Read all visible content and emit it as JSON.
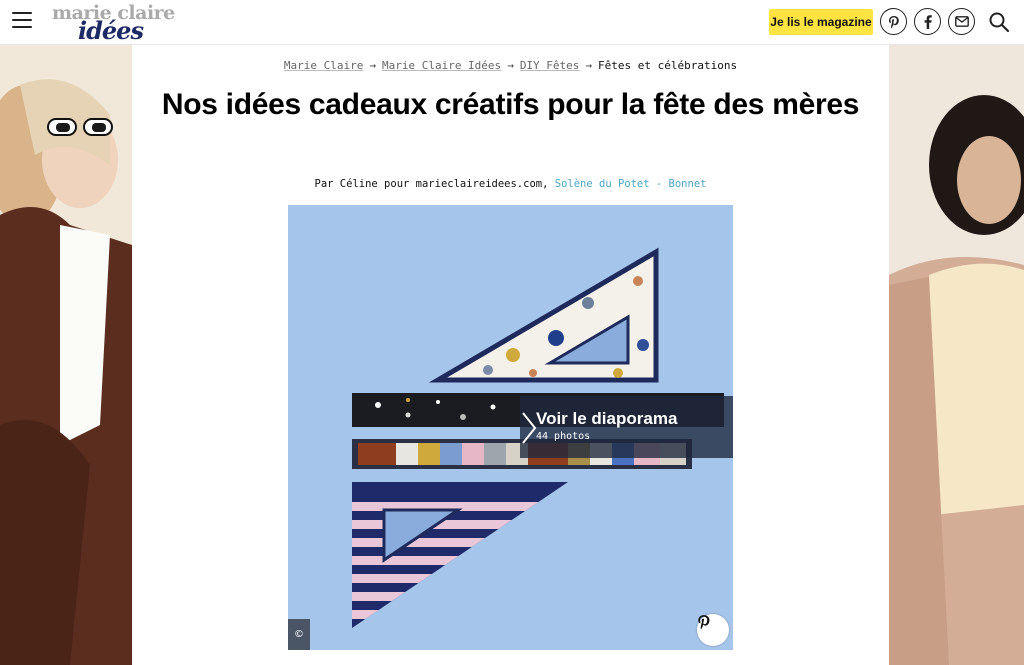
{
  "header": {
    "logo_top": "marie claire",
    "logo_bottom": "idées",
    "magazine_button": "Je lis le magazine",
    "social_icons": [
      "pinterest-icon",
      "facebook-icon",
      "newsletter-icon"
    ],
    "search_icon": "search-icon"
  },
  "breadcrumb": {
    "items": [
      "Marie Claire",
      "Marie Claire Idées",
      "DIY Fêtes"
    ],
    "current": "Fêtes et célébrations",
    "separator": "→"
  },
  "article": {
    "title": "Nos idées cadeaux créatifs pour la fête des mères",
    "byline_prefix": "Par Céline pour marieclaireidees.com,",
    "byline_author": "Solène du Potet - Bonnet"
  },
  "slideshow": {
    "label": "Voir le diaporama",
    "count": "44 photos",
    "copyright": "©"
  },
  "colors": {
    "accent_yellow": "#ffe342",
    "link_blue": "#4aa6c4",
    "hero_bg": "#a6c5ea"
  }
}
